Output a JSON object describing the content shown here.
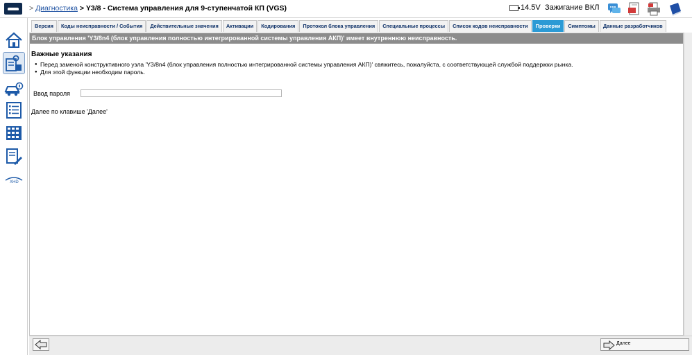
{
  "header": {
    "breadcrumb_sep": ">",
    "breadcrumb_link": "Диагностика",
    "breadcrumb_current_sep": ">",
    "breadcrumb_title": "Y3/8 - Система управления для 9-ступенчатой КП (VGS)",
    "voltage": "14.5V",
    "ignition": "Зажигание ВКЛ"
  },
  "tabs": [
    {
      "label": "Версия"
    },
    {
      "label": "Коды неисправности / События"
    },
    {
      "label": "Действительные значения"
    },
    {
      "label": "Активации"
    },
    {
      "label": "Кодирования"
    },
    {
      "label": "Протокол блока управления"
    },
    {
      "label": "Специальные процессы"
    },
    {
      "label": "Список кодов неисправности"
    },
    {
      "label": "Проверки",
      "active": true
    },
    {
      "label": "Симптомы"
    },
    {
      "label": "Данные разработчиков"
    }
  ],
  "content": {
    "banner": "Блок управления 'Y3/8n4 (блок управления полностью интегрированной системы управления АКП)' имеет внутреннюю неисправность.",
    "heading": "Важные указания",
    "bullets": [
      "Перед заменой конструктивного узла 'Y3/8n4 (блок управления полностью интегрированной системы управления АКП)' свяжитесь, пожалуйста, с соответствующей службой поддержки рынка.",
      "Для этой функции необходим пароль."
    ],
    "password_label": "Ввод пароля",
    "password_value": "",
    "hint": "Далее по клавише 'Далее'"
  },
  "footer": {
    "next_label": "Далее"
  },
  "sidebar": {
    "items": [
      {
        "icon": "home-icon"
      },
      {
        "icon": "control-unit-icon",
        "active": true
      },
      {
        "icon": "vehicle-info-icon"
      },
      {
        "icon": "list-icon"
      },
      {
        "icon": "grid-icon"
      },
      {
        "icon": "document-wrench-icon"
      },
      {
        "icon": "xhd-icon",
        "label": "XHD"
      }
    ]
  },
  "colors": {
    "tab_active": "#2b9ad5",
    "banner_bg": "#8c8c8c",
    "link": "#1b4fa0"
  }
}
